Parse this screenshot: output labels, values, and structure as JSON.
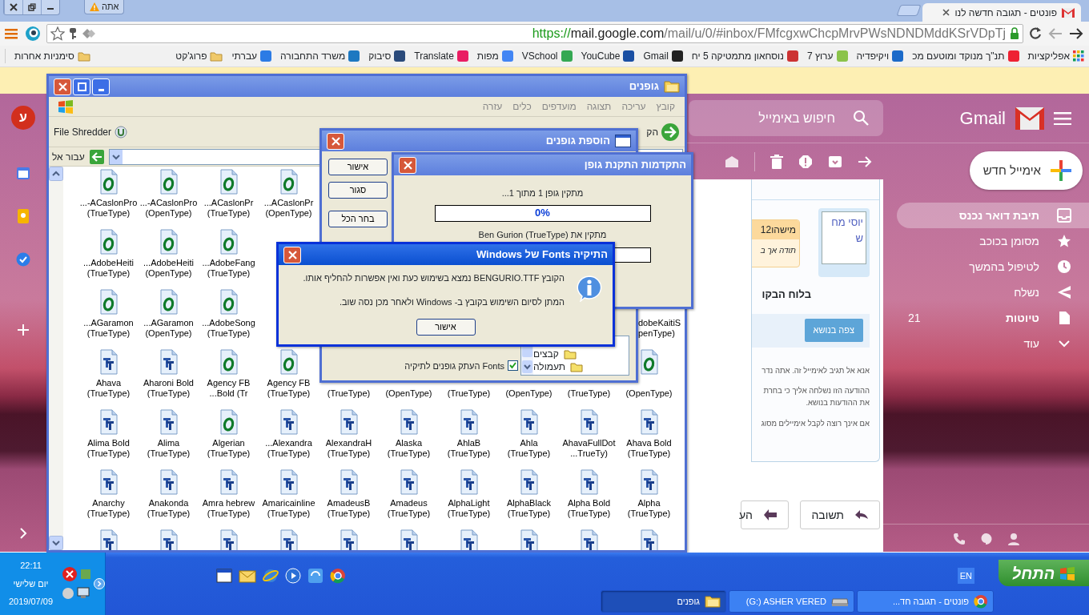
{
  "browser": {
    "profile_button": "אתה",
    "tab": {
      "title": "פונטים - תגובה חדשה לנו"
    },
    "address": {
      "scheme": "https://",
      "host": "mail.google.com",
      "path": "/mail/u/0/#inbox/FMfcgxwChcpMrvPWsNDNDMddKSrVDpTj"
    },
    "bookmarks": [
      {
        "label": "אפליקציות",
        "kind": "apps"
      },
      {
        "label": "תנ\"ך מנוקד ומוטעם מכ",
        "kind": "site"
      },
      {
        "label": "ויקיפדיה",
        "kind": "site"
      },
      {
        "label": "ערוץ 7",
        "kind": "site"
      },
      {
        "label": "נוסחאון מתמטיקה 5 יח",
        "kind": "site"
      },
      {
        "label": "Gmail",
        "kind": "site"
      },
      {
        "label": "YouCube",
        "kind": "site"
      },
      {
        "label": "VSchool",
        "kind": "site"
      },
      {
        "label": "מפות",
        "kind": "site"
      },
      {
        "label": "Translate",
        "kind": "site"
      },
      {
        "label": "סיבוק",
        "kind": "site"
      },
      {
        "label": "משרד התחבורה",
        "kind": "site"
      },
      {
        "label": "עברתי",
        "kind": "site"
      },
      {
        "label": "פרוג'קט",
        "kind": "folder"
      }
    ],
    "other_bookmarks": {
      "label": "סימניות אחרות",
      "kind": "folder"
    }
  },
  "gmail": {
    "avatar": "ע",
    "logo_text": "Gmail",
    "search": {
      "placeholder": "חיפוש באימייל"
    },
    "compose": "אימייל חדש",
    "nav": [
      {
        "label": "תיבת דואר נכנס",
        "kind": "inbox",
        "selected": true,
        "bold": true
      },
      {
        "label": "מסומן בכוכב",
        "kind": "star",
        "selected": false,
        "bold": false
      },
      {
        "label": "לטיפול בהמשך",
        "kind": "clock",
        "selected": false,
        "bold": false
      },
      {
        "label": "נשלח",
        "kind": "send",
        "selected": false,
        "bold": false
      },
      {
        "label": "טיוטות",
        "kind": "draft",
        "selected": false,
        "bold": true,
        "count": "21"
      },
      {
        "label": "עוד",
        "kind": "more",
        "selected": false,
        "bold": false
      }
    ],
    "message": {
      "image_alt": "יוסי מחש",
      "sender_tag": "מישהו12",
      "snippet": "תודה אך ב",
      "heading": "בלוח הבקו",
      "view_button": "צפה בנושא",
      "lines": [
        "אנא אל תגיב לאימייל זה. אתה נדר",
        "ההודעה הזו נשלחה אליך כי בחרת",
        "את ההודעות בנושא.",
        "אם אינך רוצה לקבל אימיילים מסוג"
      ]
    },
    "reply_buttons": [
      {
        "label": "תשובה",
        "kind": "reply"
      },
      {
        "label": "הע",
        "kind": "forward"
      }
    ]
  },
  "explorer": {
    "title": "גופנים",
    "menu": [
      "קובץ",
      "עריכה",
      "תצוגה",
      "מועדפים",
      "כלים",
      "עזרה"
    ],
    "back_label": "הק",
    "shredder": "File Shredder",
    "address_label": "עבור אל",
    "rows": [
      [
        null,
        null,
        null,
        null,
        null,
        null,
        {
          "kind": "opentype",
          "name": "...ACaslonPr",
          "type": "(OpenType)"
        },
        {
          "kind": "opentype",
          "name": "...ACaslonPr",
          "type": "(TrueType)"
        },
        {
          "kind": "opentype",
          "name": "...-ACaslonPro",
          "type": "(OpenType)"
        },
        {
          "kind": "opentype",
          "name": "...-ACaslonPro",
          "type": "(TrueType)"
        }
      ],
      [
        null,
        null,
        null,
        null,
        null,
        null,
        null,
        {
          "kind": "opentype",
          "name": "...AdobeFang",
          "type": "(TrueType)"
        },
        {
          "kind": "opentype",
          "name": "...AdobeHeiti",
          "type": "(OpenType)"
        },
        {
          "kind": "opentype",
          "name": "...AdobeHeiti",
          "type": "(TrueType)"
        }
      ],
      [
        {
          "name": "dobeKaitiS",
          "type": "penType)",
          "clipped": true
        },
        null,
        null,
        null,
        null,
        null,
        null,
        {
          "kind": "opentype",
          "name": "...AdobeSong",
          "type": "(TrueType)"
        },
        {
          "kind": "opentype",
          "name": "...AGaramon",
          "type": "(OpenType)"
        },
        {
          "kind": "opentype",
          "name": "...AGaramon",
          "type": "(TrueType)"
        }
      ],
      [
        {
          "kind": "opentype",
          "type": "(OpenType)"
        },
        {
          "type": "(TrueType)"
        },
        {
          "type": "(OpenType)"
        },
        {
          "type": "(TrueType)"
        },
        {
          "type": "(OpenType)"
        },
        {
          "type": "(TrueType)"
        },
        {
          "kind": "opentype",
          "name": "Agency FB",
          "type": "(TrueType)"
        },
        {
          "kind": "opentype",
          "name": "Agency FB",
          "type": "...Bold (Tr"
        },
        {
          "kind": "truetype",
          "name": "Aharoni Bold",
          "type": "(TrueType)"
        },
        {
          "kind": "truetype",
          "name": "Ahava",
          "type": "(TrueType)"
        }
      ],
      [
        {
          "kind": "truetype",
          "name": "Ahava Bold",
          "type": "(TrueType)"
        },
        {
          "kind": "truetype",
          "name": "AhavaFullDot",
          "type": "...TrueTy)"
        },
        {
          "kind": "truetype",
          "name": "Ahla",
          "type": "(TrueType)"
        },
        {
          "kind": "truetype",
          "name": "AhlaB",
          "type": "(TrueType)"
        },
        {
          "kind": "truetype",
          "name": "Alaska",
          "type": "(TrueType)"
        },
        {
          "kind": "truetype",
          "name": "AlexandraH",
          "type": "(TrueType)"
        },
        {
          "kind": "truetype",
          "name": "...Alexandra",
          "type": "(TrueType)"
        },
        {
          "kind": "opentype",
          "name": "Algerian",
          "type": "(TrueType)"
        },
        {
          "kind": "truetype",
          "name": "Alima",
          "type": "(TrueType)"
        },
        {
          "kind": "truetype",
          "name": "Alima Bold",
          "type": "(TrueType)"
        }
      ],
      [
        {
          "kind": "truetype",
          "name": "Alpha",
          "type": "(TrueType)"
        },
        {
          "kind": "truetype",
          "name": "Alpha Bold",
          "type": "(TrueType)"
        },
        {
          "kind": "truetype",
          "name": "AlphaBlack",
          "type": "(TrueType)"
        },
        {
          "kind": "truetype",
          "name": "AlphaLight",
          "type": "(TrueType)"
        },
        {
          "kind": "truetype",
          "name": "Amadeus",
          "type": "(TrueType)"
        },
        {
          "kind": "truetype",
          "name": "AmadeusB",
          "type": "(TrueType)"
        },
        {
          "kind": "truetype",
          "name": "Amaricainline",
          "type": "(TrueType)"
        },
        {
          "kind": "truetype",
          "name": "Amra hebrew",
          "type": "(TrueType)"
        },
        {
          "kind": "truetype",
          "name": "Anakonda",
          "type": "(TrueType)"
        },
        {
          "kind": "truetype",
          "name": "Anarchy",
          "type": "(TrueType)"
        }
      ],
      [
        {
          "kind": "truetype"
        },
        {
          "kind": "truetype"
        },
        {
          "kind": "truetype"
        },
        {
          "kind": "truetype"
        },
        {
          "kind": "truetype"
        },
        {
          "kind": "truetype"
        },
        {
          "kind": "truetype"
        },
        {
          "kind": "truetype"
        },
        {
          "kind": "truetype"
        },
        {
          "kind": "truetype"
        }
      ]
    ]
  },
  "add_fonts": {
    "title": "הוספת גופנים",
    "buttons": [
      "אישור",
      "סגור",
      "בחר הכל"
    ],
    "folders": [
      "קבצים",
      "תעמולה"
    ],
    "copy_to_fonts": {
      "label": "העתק גופנים לתיקיה Fonts",
      "checked": true
    }
  },
  "progress": {
    "title": "התקדמות התקנת גופן",
    "status": "מתקין גופן 1 מתוך 1...",
    "level": 0,
    "percent": "0%",
    "installing": "מתקין את Ben Gurion (TrueType)"
  },
  "message_box": {
    "title": "התיקיה Fonts של Windows",
    "lines": [
      "הקובץ BENGURIO.TTF נמצא בשימוש כעת ואין אפשרות להחליף אותו.",
      "המתן לסיום השימוש בקובץ ב- Windows ולאחר מכן נסה שוב."
    ],
    "button": "אישור"
  },
  "taskbar": {
    "start": "התחל",
    "language": "EN",
    "tasks": [
      {
        "label": "פונטים - תגובה חד...",
        "kind": "chrome",
        "selected": false
      },
      {
        "label": "(G:) ASHER VERED",
        "kind": "drive",
        "selected": false
      },
      {
        "label": "גופנים",
        "kind": "folder",
        "selected": true
      }
    ],
    "clock": {
      "time": "22:11",
      "day": "יום שלישי",
      "date": "2019/07/09"
    }
  }
}
